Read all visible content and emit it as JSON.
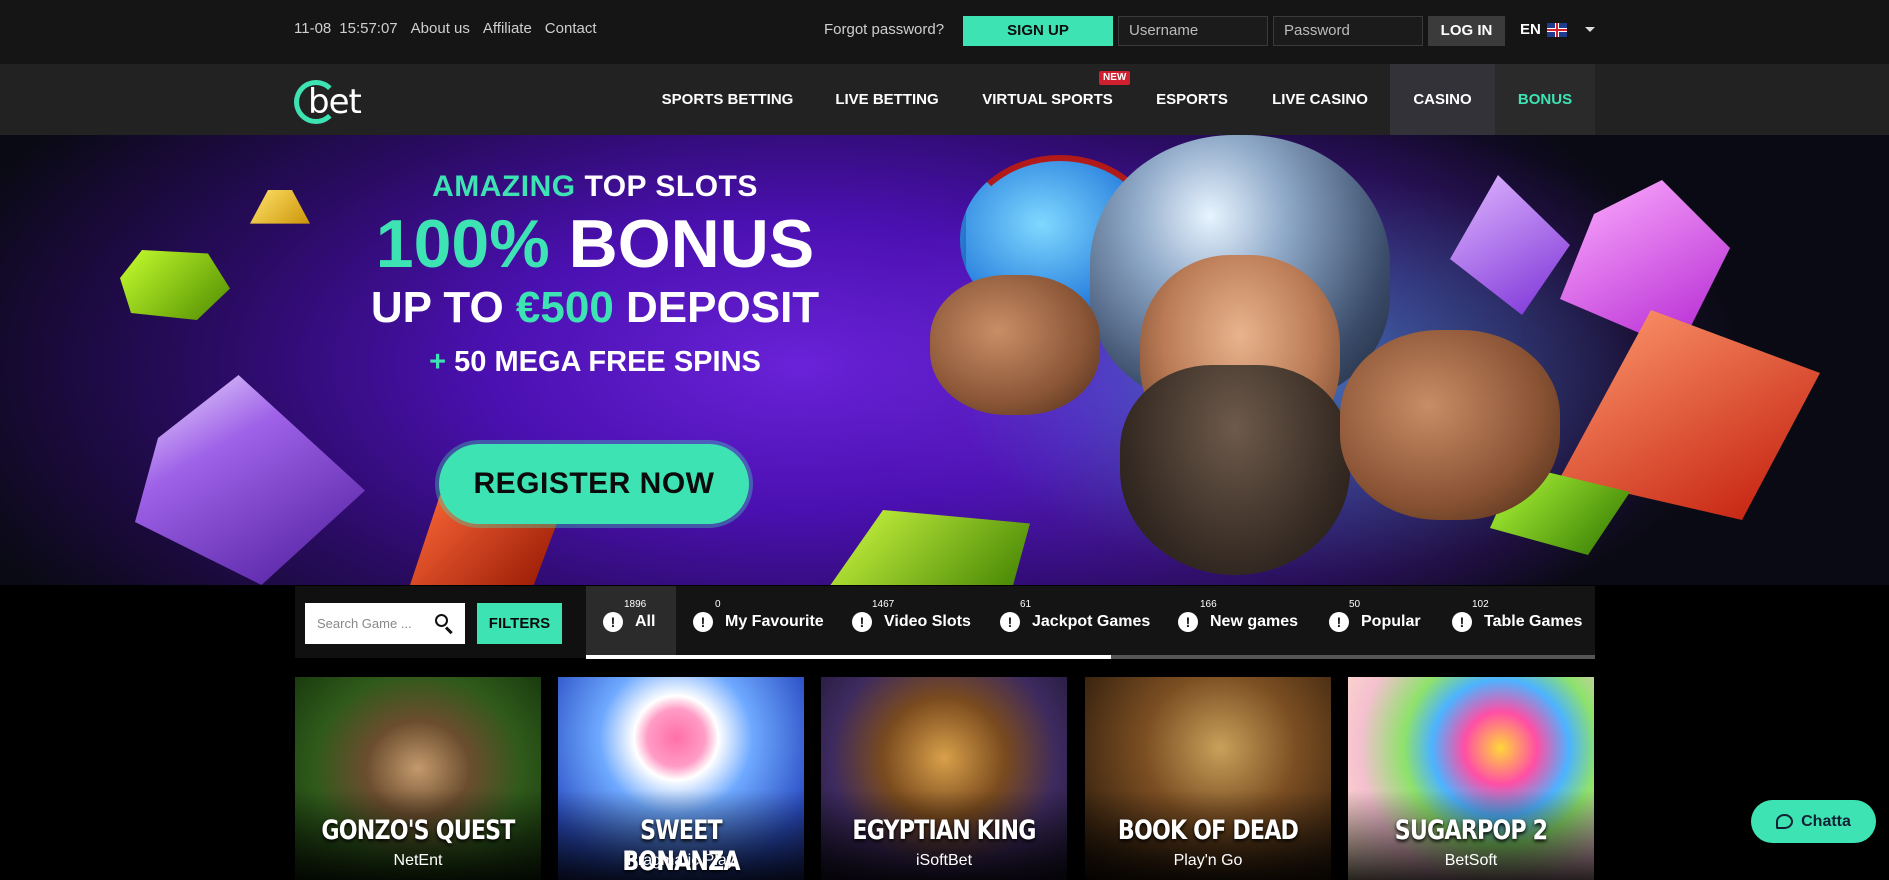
{
  "topbar": {
    "date": "11-08",
    "time": "15:57:07",
    "links": [
      "About us",
      "Affiliate",
      "Contact"
    ],
    "forgot_password": "Forgot password?",
    "signup_label": "SIGN UP",
    "username_placeholder": "Username",
    "password_placeholder": "Password",
    "login_label": "LOG IN",
    "language": "EN"
  },
  "brand": {
    "logo_text": "bet",
    "accent_color": "#3ee3b3"
  },
  "nav": {
    "items": [
      "SPORTS BETTING",
      "LIVE BETTING",
      "VIRTUAL SPORTS",
      "ESPORTS",
      "LIVE CASINO",
      "CASINO",
      "BONUS"
    ],
    "new_badge": "NEW",
    "active": "CASINO"
  },
  "hero": {
    "line1_accent": "AMAZING",
    "line1_rest": "TOP SLOTS",
    "line2_accent": "100%",
    "line2_rest": "BONUS",
    "line3_a": "UP TO",
    "line3_accent": "€500",
    "line3_b": "DEPOSIT",
    "line4_accent": "+",
    "line4_rest": "50 MEGA FREE SPINS",
    "register_label": "REGISTER NOW"
  },
  "games_filter": {
    "search_placeholder": "Search Game ...",
    "filters_label": "FILTERS",
    "categories": [
      {
        "label": "All",
        "count": "1896"
      },
      {
        "label": "My Favourite",
        "count": "0"
      },
      {
        "label": "Video Slots",
        "count": "1467"
      },
      {
        "label": "Jackpot Games",
        "count": "61"
      },
      {
        "label": "New games",
        "count": "166"
      },
      {
        "label": "Popular",
        "count": "50"
      },
      {
        "label": "Table Games",
        "count": "102"
      }
    ],
    "scroll_progress": 0.52
  },
  "games": [
    {
      "title": "GONZO'S QUEST",
      "provider": "NetEnt"
    },
    {
      "title": "SWEET BONANZA",
      "provider": "Pragmatic Play"
    },
    {
      "title": "EGYPTIAN KING",
      "provider": "iSoftBet"
    },
    {
      "title": "BOOK OF DEAD",
      "provider": "Play'n Go"
    },
    {
      "title": "SUGARPOP 2",
      "provider": "BetSoft"
    }
  ],
  "chat": {
    "label": "Chatta"
  }
}
